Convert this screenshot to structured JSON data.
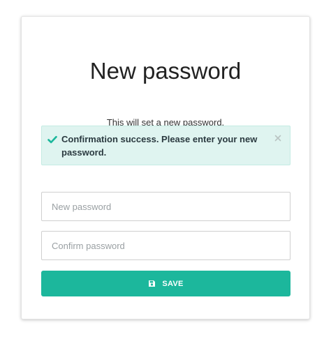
{
  "page": {
    "title": "New password",
    "subtitle": "This will set a new password."
  },
  "alert": {
    "message": "Confirmation success. Please enter your new password.",
    "icon": "check-icon",
    "close_icon": "close-icon",
    "accent_color": "#1cb79c",
    "background_color": "#dff4f0"
  },
  "form": {
    "new_password": {
      "placeholder": "New password",
      "value": ""
    },
    "confirm_password": {
      "placeholder": "Confirm password",
      "value": ""
    },
    "save_button": {
      "label": "SAVE",
      "icon": "save-icon",
      "color": "#1cb79c"
    }
  }
}
